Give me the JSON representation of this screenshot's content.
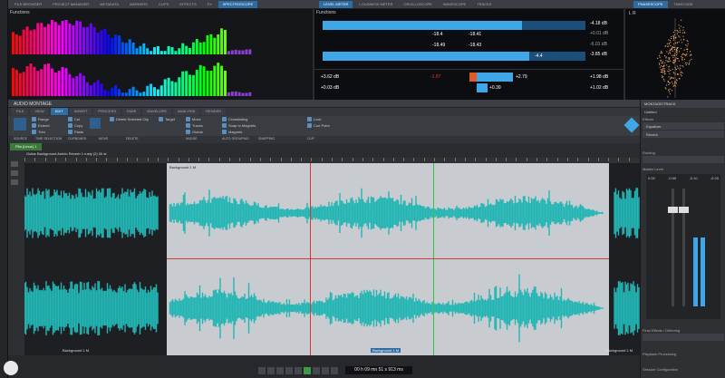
{
  "left_tool_tabs": [
    "FILE BROWSER",
    "PROJECT MANAGER",
    "METADATA",
    "MARKERS",
    "CLIPS",
    "EFFECTS",
    "FX",
    "SPECTROSCOPE"
  ],
  "mid_tool_tabs": [
    "LEVEL METER",
    "LOUDNESS METER",
    "OSCILLOSCOPE",
    "WAVESCOPE",
    "TRACKS"
  ],
  "right_tool_tabs": [
    "PHASESCOPE",
    "TIMECODE"
  ],
  "functions_label": "Functions",
  "level_meter": {
    "top_left": "-18.4",
    "top_mid": "-18.41",
    "top_right": "-4.18 dB",
    "top_right2": "+0.01 dB",
    "bot_left": "-18.49",
    "bot_mid": "-18.43",
    "bot_right": "-3.85 dB",
    "bot_right2": "-6.01 dB",
    "bot_marker": "-4.4",
    "summary_left1": "+3.62 dB",
    "summary_left2": "+0.03 dB",
    "summary_red": "-1.87",
    "summary_bar1": "+2.79",
    "summary_bar2": "+0.39",
    "summary_right1": "+1.98 dB",
    "summary_right2": "+1.02 dB"
  },
  "phasescope_value": "L R",
  "montage_title": "AUDIO MONTAGE",
  "ribbon_tabs": [
    "FILE",
    "VIEW",
    "EDIT",
    "INSERT",
    "PROCESS",
    "FADE",
    "ENVELOPE",
    "ANALYSIS",
    "RENDER"
  ],
  "ribbon_active": "EDIT",
  "ribbon_items": {
    "tools": [
      "Range",
      "Extend",
      "Trim"
    ],
    "clipboard": [
      "Cut",
      "Copy",
      "Paste"
    ],
    "delete": [
      "Delete Selected Clip"
    ],
    "move": [
      "Left",
      "Right"
    ],
    "target": [
      "Target"
    ],
    "nudge": [
      "Move",
      "Tracks",
      "Global"
    ],
    "crossfade": [
      "Crossfading",
      "Snap to Magnets",
      "Magnets"
    ],
    "clip": [
      "Lock",
      "Cue Point"
    ]
  },
  "ribbon_groups": [
    "SOURCE",
    "TIME SELECTION",
    "CLIPBOARD",
    "MOVE",
    "DELETE",
    "NUDGE",
    "AUTO GROUPING",
    "SNAPPING",
    "CLIP"
  ],
  "file_tab": "Pila (Linux) 1",
  "clip_title": "Guitar Background Ambio Reverb 1 rusty (2) 00 st",
  "clip_label_top": "Background 1 M",
  "clip_label_bottom_left": "Background 1 M",
  "clip_label_bottom_right": "Background 1 M",
  "clip_label_bottom_mid": "Background 1 M",
  "transport_time": "00 h 09 mn 51 s 913 ms",
  "right_panel": {
    "title": "MONTAGE/TRACK",
    "subtitle": "Untitled",
    "sections": [
      "Effects",
      "Routing",
      "Master Level",
      "Final Effects / Dithering",
      "Playback Processing",
      "Session Configuration"
    ],
    "fx_items": [
      "Equalizer",
      "Reverb"
    ],
    "meter_values": [
      "0.00",
      "-0.00",
      "-0.10",
      "-0.20"
    ]
  },
  "colors": {
    "accent": "#2e6da4",
    "waveform": "#22b5b4",
    "cursor_red": "#e0352b",
    "cursor_green": "#33c24a",
    "meter_blue": "#3fa7e8"
  }
}
